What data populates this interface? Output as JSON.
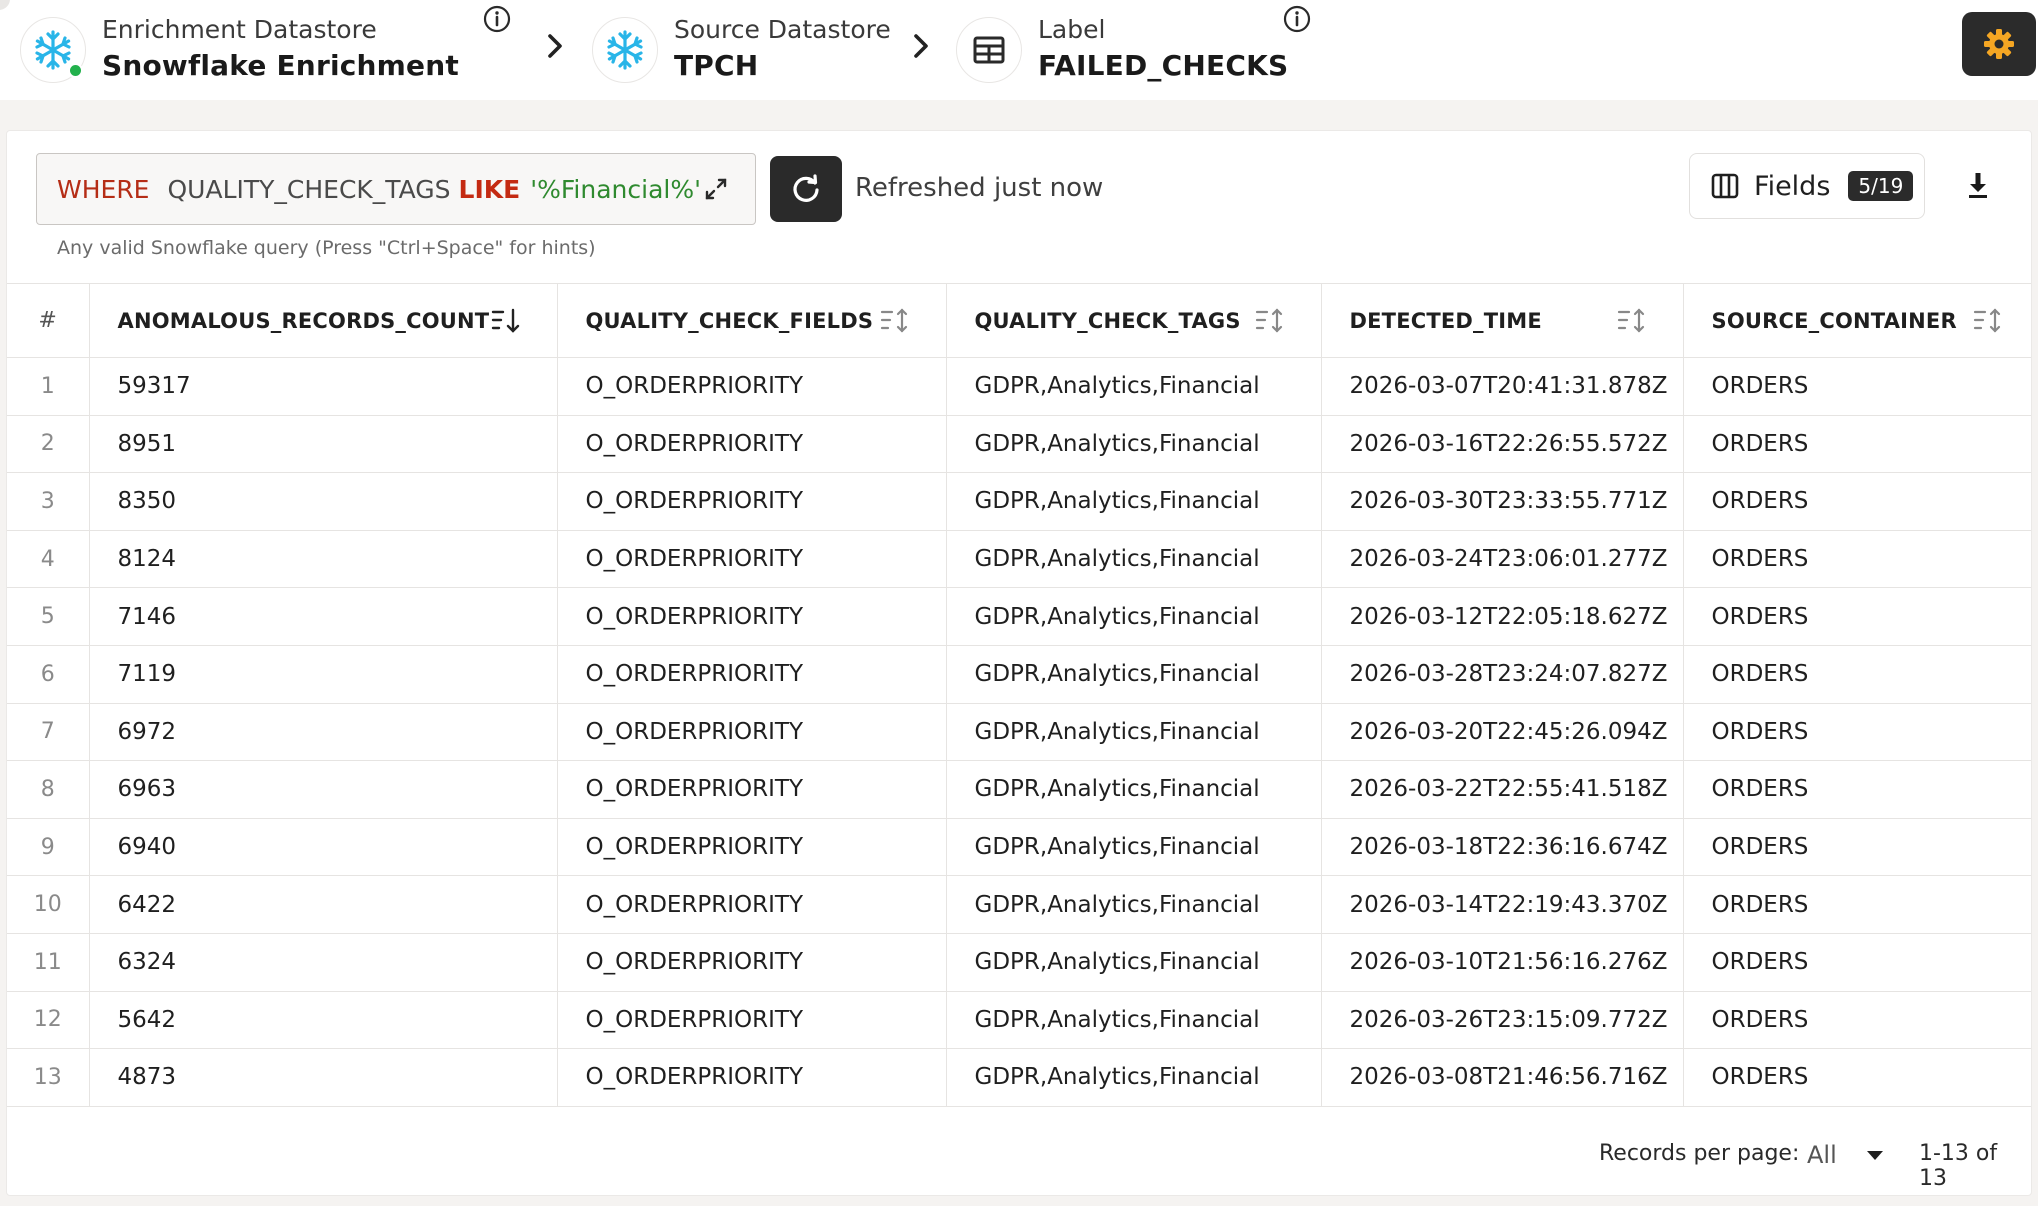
{
  "header": {
    "enrichment": {
      "label": "Enrichment Datastore",
      "value": "Snowflake Enrichment"
    },
    "source": {
      "label": "Source Datastore",
      "value": "TPCH"
    },
    "table": {
      "label": "Label",
      "value": "FAILED_CHECKS"
    }
  },
  "query": {
    "where_kw": "WHERE",
    "field": "QUALITY_CHECK_TAGS",
    "like_kw": "LIKE",
    "string": "'%Financial%'",
    "hint": "Any valid Snowflake query (Press \"Ctrl+Space\" for hints)"
  },
  "refreshed": "Refreshed just now",
  "fields": {
    "label": "Fields",
    "badge": "5/19"
  },
  "table": {
    "index_header": "#",
    "columns": [
      "ANOMALOUS_RECORDS_COUNT",
      "QUALITY_CHECK_FIELDS",
      "QUALITY_CHECK_TAGS",
      "DETECTED_TIME",
      "SOURCE_CONTAINER"
    ],
    "rows": [
      [
        "1",
        "59317",
        "O_ORDERPRIORITY",
        "GDPR,Analytics,Financial",
        "2026-03-07T20:41:31.878Z",
        "ORDERS"
      ],
      [
        "2",
        "8951",
        "O_ORDERPRIORITY",
        "GDPR,Analytics,Financial",
        "2026-03-16T22:26:55.572Z",
        "ORDERS"
      ],
      [
        "3",
        "8350",
        "O_ORDERPRIORITY",
        "GDPR,Analytics,Financial",
        "2026-03-30T23:33:55.771Z",
        "ORDERS"
      ],
      [
        "4",
        "8124",
        "O_ORDERPRIORITY",
        "GDPR,Analytics,Financial",
        "2026-03-24T23:06:01.277Z",
        "ORDERS"
      ],
      [
        "5",
        "7146",
        "O_ORDERPRIORITY",
        "GDPR,Analytics,Financial",
        "2026-03-12T22:05:18.627Z",
        "ORDERS"
      ],
      [
        "6",
        "7119",
        "O_ORDERPRIORITY",
        "GDPR,Analytics,Financial",
        "2026-03-28T23:24:07.827Z",
        "ORDERS"
      ],
      [
        "7",
        "6972",
        "O_ORDERPRIORITY",
        "GDPR,Analytics,Financial",
        "2026-03-20T22:45:26.094Z",
        "ORDERS"
      ],
      [
        "8",
        "6963",
        "O_ORDERPRIORITY",
        "GDPR,Analytics,Financial",
        "2026-03-22T22:55:41.518Z",
        "ORDERS"
      ],
      [
        "9",
        "6940",
        "O_ORDERPRIORITY",
        "GDPR,Analytics,Financial",
        "2026-03-18T22:36:16.674Z",
        "ORDERS"
      ],
      [
        "10",
        "6422",
        "O_ORDERPRIORITY",
        "GDPR,Analytics,Financial",
        "2026-03-14T22:19:43.370Z",
        "ORDERS"
      ],
      [
        "11",
        "6324",
        "O_ORDERPRIORITY",
        "GDPR,Analytics,Financial",
        "2026-03-10T21:56:16.276Z",
        "ORDERS"
      ],
      [
        "12",
        "5642",
        "O_ORDERPRIORITY",
        "GDPR,Analytics,Financial",
        "2026-03-26T23:15:09.772Z",
        "ORDERS"
      ],
      [
        "13",
        "4873",
        "O_ORDERPRIORITY",
        "GDPR,Analytics,Financial",
        "2026-03-08T21:46:56.716Z",
        "ORDERS"
      ]
    ]
  },
  "pagination": {
    "records_label": "Records per page:",
    "selected": "All",
    "range": "1-13 of 13"
  },
  "icons": {
    "datastore": "snowflake-icon",
    "table": "table-icon",
    "info": "info-icon",
    "separator": "chevron-right-icon",
    "settings": "gear-icon",
    "expand": "expand-icon",
    "refresh": "refresh-icon",
    "fields": "columns-icon",
    "download": "download-icon",
    "sort": "sort-icon"
  },
  "colors": {
    "accent_orange": "#f5a623",
    "status_green": "#22b14c",
    "snowflake_blue": "#29b5e8",
    "keyword_red": "#b52d16",
    "string_green": "#2f8a2f"
  }
}
